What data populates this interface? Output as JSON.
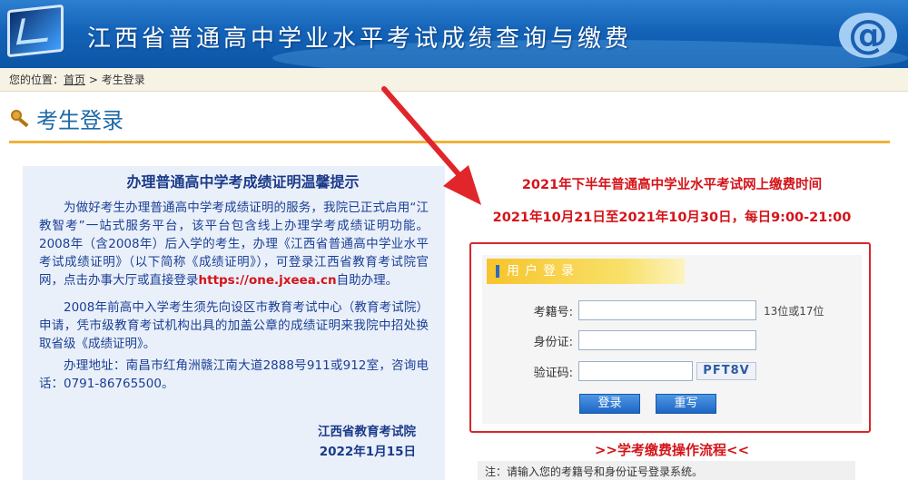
{
  "header": {
    "title": "江西省普通高中学业水平考试成绩查询与缴费",
    "logo_icon": "monitor-icon",
    "right_icon": "at-sign-icon",
    "right_icon_glyph": "@"
  },
  "breadcrumb": {
    "prefix": "您的位置：",
    "home_link": "首页",
    "separator": " > ",
    "current": "考生登录"
  },
  "page": {
    "title": "考生登录",
    "title_icon": "key-icon"
  },
  "notice": {
    "title": "办理普通高中学考成绩证明温馨提示",
    "para1_before_url": "为做好考生办理普通高中学考成绩证明的服务，我院已正式启用“江教智考”一站式服务平台，该平台包含线上办理学考成绩证明功能。2008年（含2008年）后入学的考生，办理《江西省普通高中学业水平考试成绩证明》（以下简称《成绩证明》），可登录江西省教育考试院官网，点击办事大厅或直接登录",
    "para1_url": "https://one.jxeea.cn",
    "para1_after_url": "自助办理。",
    "para2": "2008年前高中入学考生须先向设区市教育考试中心（教育考试院）申请，凭市级教育考试机构出具的加盖公章的成绩证明来我院中招处换取省级《成绩证明》。",
    "para3": "办理地址：南昌市红角洲赣江南大道2888号911或912室，咨询电话：0791-86765500。",
    "sign_org": "江西省教育考试院",
    "sign_date": "2022年1月15日"
  },
  "fee_notice": {
    "line1": "2021年下半年普通高中学业水平考试网上缴费时间",
    "line2": "2021年10月21日至2021年10月30日，每日9:00-21:00"
  },
  "login": {
    "tab_label": "用户登录",
    "fields": {
      "exam_no_label": "考籍号:",
      "exam_no_value": "",
      "exam_no_hint": "13位或17位",
      "id_label": "身份证:",
      "id_value": "",
      "captcha_label": "验证码:",
      "captcha_value": "",
      "captcha_image_text": "PFT8V"
    },
    "login_button": "登录",
    "reset_button": "重写"
  },
  "flow": {
    "title": ">>学考缴费操作流程<<",
    "note": "注：请输入您的考籍号和身份证号登录系统。"
  },
  "colors": {
    "banner_blue": "#1463b8",
    "accent_red": "#d4141a",
    "heading_blue": "#1e6aa8",
    "rule_orange": "#f0b23a",
    "notice_bg": "#eaf0f9",
    "tab_yellow": "#f7c42c"
  }
}
